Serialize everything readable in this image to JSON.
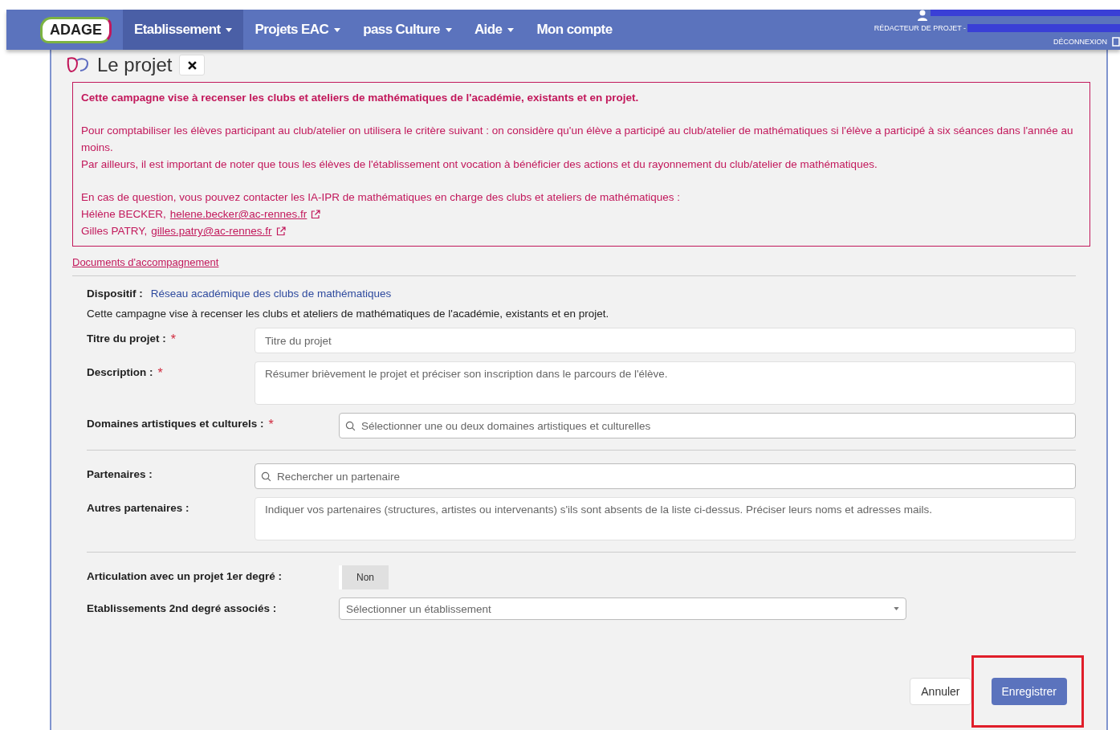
{
  "nav": {
    "logo": "ADAGE",
    "items": [
      {
        "label": "Etablissement",
        "dropdown": true,
        "selected": true
      },
      {
        "label": "Projets EAC",
        "dropdown": true,
        "selected": false
      },
      {
        "label": "pass Culture",
        "dropdown": true,
        "selected": false
      },
      {
        "label": "Aide",
        "dropdown": true,
        "selected": false
      },
      {
        "label": "Mon compte",
        "dropdown": false,
        "selected": false
      }
    ],
    "user": {
      "role": "RÉDACTEUR DE PROJET -",
      "logout": "DÉCONNEXION"
    }
  },
  "panel": {
    "title": "Le projet"
  },
  "notice": {
    "heading": "Cette campagne vise à recenser les clubs et ateliers de mathématiques de l'académie, existants et en projet.",
    "paragraphs": [
      "Pour comptabiliser les élèves participant au club/atelier on utilisera le critère suivant : on considère qu'un élève a participé au club/atelier de mathématiques si l'élève a participé à six séances dans l'année au moins.",
      "Par ailleurs, il est important de noter que tous les élèves de l'établissement ont vocation à bénéficier des actions et du rayonnement du club/atelier de mathématiques."
    ],
    "contact_intro": "En cas de question, vous pouvez contacter les IA-IPR de mathématiques en charge des clubs et ateliers de mathématiques :",
    "contacts": [
      {
        "name": "Hélène BECKER,",
        "email": "helene.becker@ac-rennes.fr"
      },
      {
        "name": "Gilles PATRY,",
        "email": "gilles.patry@ac-rennes.fr"
      }
    ]
  },
  "documents_link": "Documents d'accompagnement",
  "form": {
    "dispositif": {
      "label": "Dispositif :",
      "value": "Réseau académique des clubs de mathématiques"
    },
    "intro": "Cette campagne vise à recenser les clubs et ateliers de mathématiques de l'académie, existants et en projet.",
    "sections": [
      [
        {
          "kind": "text",
          "label": "Titre du projet :",
          "required_mark": "*",
          "placeholder": "Titre du projet"
        },
        {
          "kind": "textarea",
          "label": "Description :",
          "required_mark": "*",
          "placeholder": "Résumer brièvement le projet et préciser son inscription dans le parcours de l'élève."
        },
        {
          "kind": "search",
          "label": "Domaines artistiques et culturels :",
          "required_mark": "*",
          "placeholder": "Sélectionner une ou deux domaines artistiques et culturelles"
        }
      ],
      [
        {
          "kind": "search",
          "label": "Partenaires :",
          "placeholder": "Rechercher un partenaire"
        },
        {
          "kind": "textarea",
          "label": "Autres partenaires :",
          "placeholder": "Indiquer vos partenaires (structures, artistes ou intervenants) s'ils sont absents de la liste ci-dessus. Préciser leurs noms et adresses mails."
        }
      ],
      [
        {
          "kind": "toggle",
          "label": "Articulation avec un projet 1er degré :",
          "value": "Non",
          "on": false
        },
        {
          "kind": "select",
          "label": "Etablissements 2nd degré associés :",
          "placeholder": "Sélectionner un établissement"
        }
      ]
    ]
  },
  "buttons": [
    {
      "label": "Annuler",
      "kind": "secondary",
      "highlighted": false
    },
    {
      "label": "Enregistrer",
      "kind": "primary",
      "highlighted": true
    }
  ]
}
